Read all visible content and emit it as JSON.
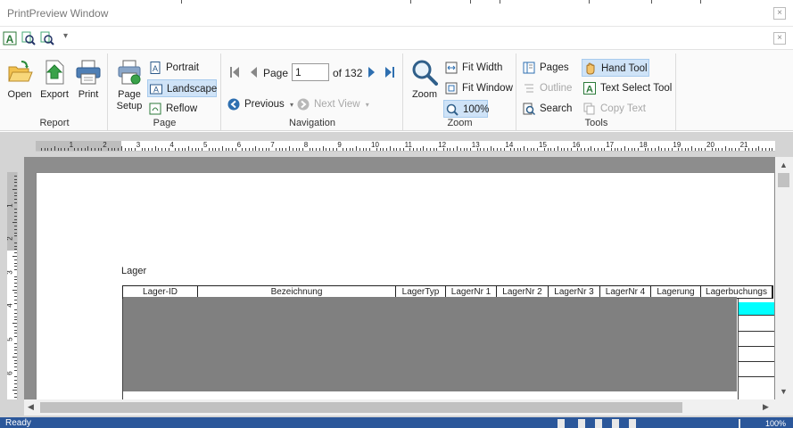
{
  "window": {
    "title": "PrintPreview Window",
    "close_glyph": "×"
  },
  "qat": {
    "dropdown_glyph": "▾"
  },
  "ribbon": {
    "report": {
      "label": "Report",
      "open": "Open",
      "export": "Export",
      "print": "Print"
    },
    "page": {
      "label": "Page",
      "setup_line1": "Page",
      "setup_line2": "Setup",
      "portrait": "Portrait",
      "landscape": "Landscape",
      "reflow": "Reflow"
    },
    "navigation": {
      "label": "Navigation",
      "page_label": "Page",
      "page_value": "1",
      "of_label": "of 132",
      "previous": "Previous",
      "next_view": "Next View"
    },
    "zoom": {
      "label": "Zoom",
      "zoom": "Zoom",
      "fit_width": "Fit Width",
      "fit_window": "Fit Window",
      "percent": "100%"
    },
    "tools": {
      "label": "Tools",
      "pages": "Pages",
      "outline": "Outline",
      "search": "Search",
      "hand_tool": "Hand Tool",
      "text_select": "Text Select Tool",
      "copy_text": "Copy Text"
    }
  },
  "rulers": {
    "h_numbers": [
      "1",
      "2",
      "3",
      "4",
      "5",
      "6",
      "7",
      "8",
      "9",
      "10",
      "11",
      "12",
      "13",
      "14",
      "15",
      "16",
      "17",
      "18",
      "19",
      "20",
      "21"
    ],
    "v_numbers": [
      "1",
      "2",
      "3",
      "4",
      "5",
      "6"
    ]
  },
  "report": {
    "title": "Lager",
    "columns": [
      "Lager-ID",
      "Bezeichnung",
      "LagerTyp",
      "LagerNr 1",
      "LagerNr 2",
      "LagerNr 3",
      "LagerNr 4",
      "Lagerung",
      "Lagerbuchungs"
    ]
  },
  "status": {
    "left_text": "Ready",
    "zoom_text": "100%"
  },
  "colors": {
    "accent": "#2b579a",
    "selected": "#cfe3f7",
    "highlight_cell": "#00ffff",
    "redaction": "#808080",
    "nav_blue": "#2e6fb0"
  }
}
